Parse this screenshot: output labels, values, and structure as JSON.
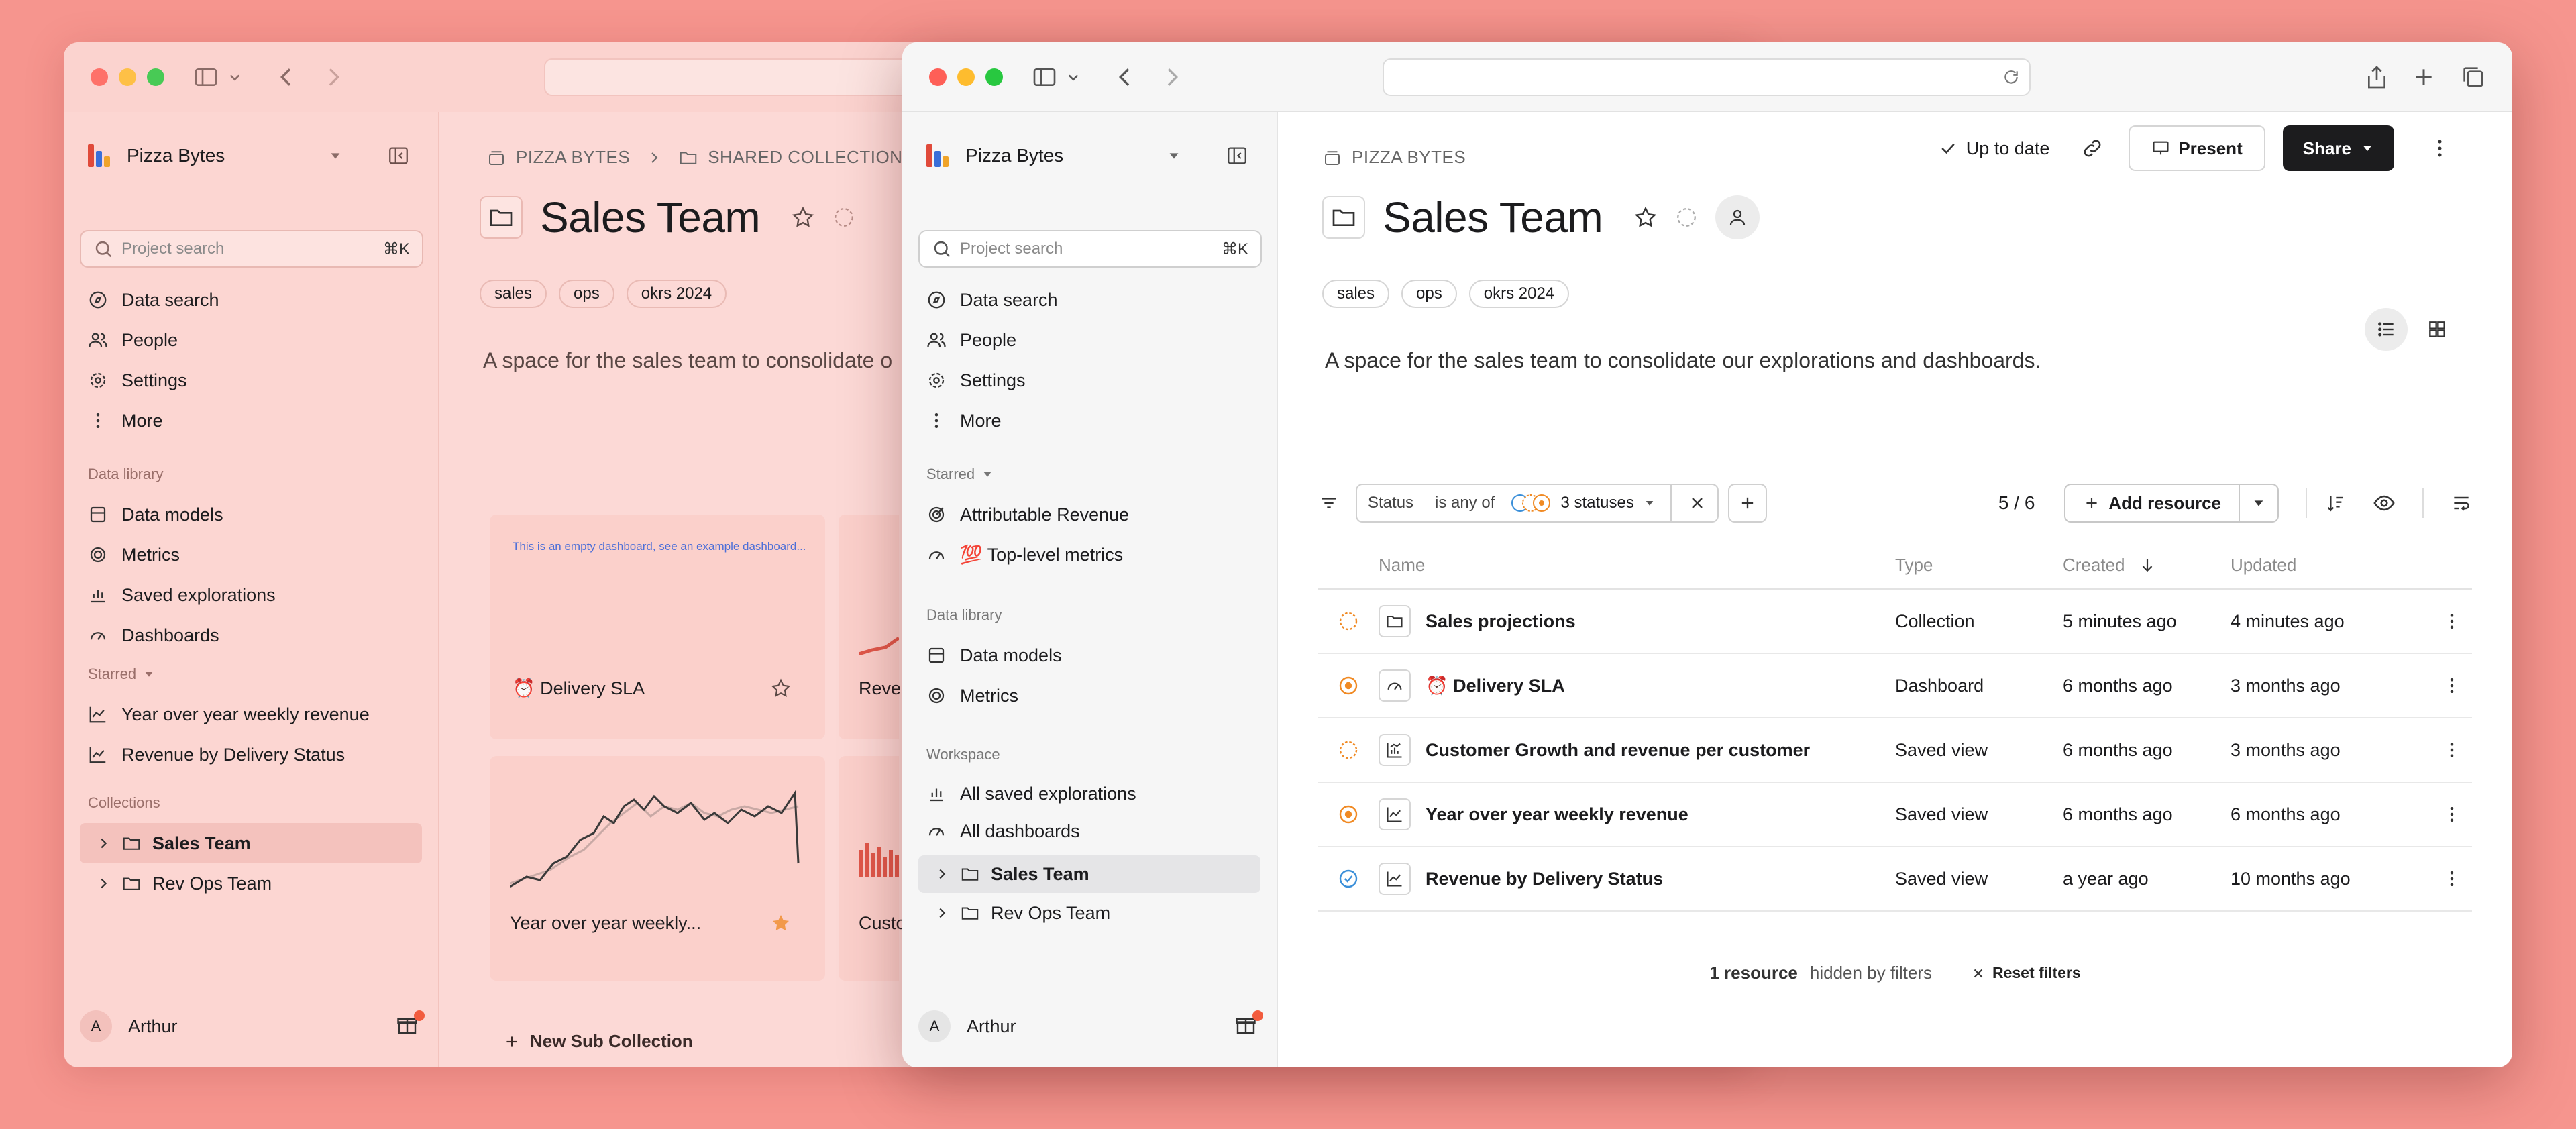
{
  "back_window": {
    "workspace": "Pizza Bytes",
    "search_placeholder": "Project search",
    "search_shortcut": "⌘K",
    "nav": [
      "Data search",
      "People",
      "Settings",
      "More"
    ],
    "data_library_label": "Data library",
    "data_library": [
      "Data models",
      "Metrics",
      "Saved explorations",
      "Dashboards"
    ],
    "starred_label": "Starred",
    "starred": [
      "Year over year weekly revenue",
      "Revenue by Delivery Status"
    ],
    "collections_label": "Collections",
    "collections": [
      "Sales Team",
      "Rev Ops Team"
    ],
    "user": "Arthur",
    "user_initial": "A",
    "breadcrumb": [
      "PIZZA BYTES",
      "SHARED COLLECTIONS"
    ],
    "title": "Sales Team",
    "tags": [
      "sales",
      "ops",
      "okrs 2024"
    ],
    "description": "A space for the sales team to consolidate o",
    "cards": [
      {
        "name": "⏰ Delivery SLA",
        "note": "This is an empty dashboard, see an example dashboard..."
      },
      {
        "name": "Reve"
      },
      {
        "name": "Year over year weekly..."
      },
      {
        "name": "Custo"
      }
    ],
    "new_sub_collection": "New Sub Collection"
  },
  "front_window": {
    "workspace": "Pizza Bytes",
    "search_placeholder": "Project search",
    "search_shortcut": "⌘K",
    "nav": [
      "Data search",
      "People",
      "Settings",
      "More"
    ],
    "starred_label": "Starred",
    "starred": [
      "Attributable Revenue",
      "💯 Top-level metrics"
    ],
    "data_library_label": "Data library",
    "data_library": [
      "Data models",
      "Metrics"
    ],
    "workspace_label": "Workspace",
    "workspace_items": [
      "All saved explorations",
      "All dashboards"
    ],
    "collections": [
      "Sales Team",
      "Rev Ops Team"
    ],
    "user": "Arthur",
    "user_initial": "A",
    "breadcrumb": "PIZZA BYTES",
    "toolbar": {
      "status": "Up to date",
      "present": "Present",
      "share": "Share"
    },
    "title": "Sales Team",
    "tags": [
      "sales",
      "ops",
      "okrs 2024"
    ],
    "description": "A space for the sales team to consolidate our explorations and dashboards.",
    "filter": {
      "field": "Status",
      "op": "is any of",
      "value": "3 statuses"
    },
    "count": "5 / 6",
    "add_resource": "Add resource",
    "columns": [
      "Name",
      "Type",
      "Created",
      "Updated"
    ],
    "rows": [
      {
        "name": "Sales projections",
        "type": "Collection",
        "created": "5 minutes ago",
        "updated": "4 minutes ago",
        "status": "dashed",
        "icon": "folder-icon"
      },
      {
        "name": "⏰ Delivery SLA",
        "type": "Dashboard",
        "created": "6 months ago",
        "updated": "3 months ago",
        "status": "orange",
        "icon": "gauge-icon"
      },
      {
        "name": "Customer Growth and revenue per customer",
        "type": "Saved view",
        "created": "6 months ago",
        "updated": "3 months ago",
        "status": "dashed",
        "icon": "chart-icon"
      },
      {
        "name": "Year over year weekly revenue",
        "type": "Saved view",
        "created": "6 months ago",
        "updated": "6 months ago",
        "status": "orange",
        "icon": "line-chart-icon"
      },
      {
        "name": "Revenue by Delivery Status",
        "type": "Saved view",
        "created": "a year ago",
        "updated": "10 months ago",
        "status": "blue-check",
        "icon": "line-chart-icon"
      }
    ],
    "hidden_count": "1 resource",
    "hidden_text": "hidden by filters",
    "reset_filters": "Reset filters"
  },
  "colors": {
    "background": "#f6958e",
    "orange_status": "#f08a24",
    "blue_status": "#3a8fd9",
    "dark_button": "#1c1c1e"
  }
}
